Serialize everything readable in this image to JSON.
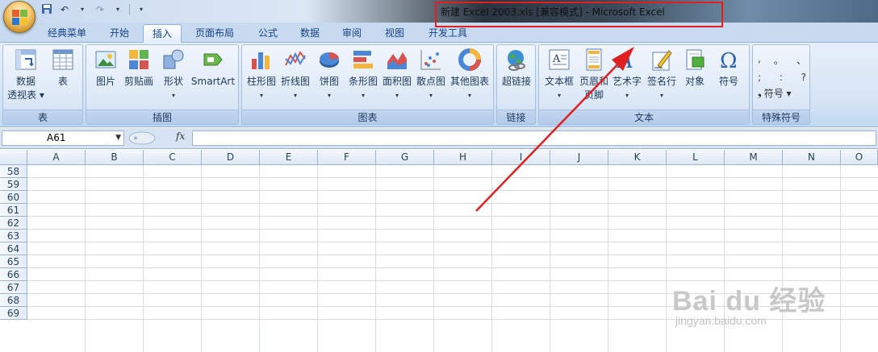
{
  "window": {
    "title": "新建 Excel 2003.xls  [兼容模式] - Microsoft Excel"
  },
  "tabs": [
    {
      "label": "经典菜单",
      "active": false
    },
    {
      "label": "开始",
      "active": false
    },
    {
      "label": "插入",
      "active": true
    },
    {
      "label": "页面布局",
      "active": false
    },
    {
      "label": "公式",
      "active": false
    },
    {
      "label": "数据",
      "active": false
    },
    {
      "label": "审阅",
      "active": false
    },
    {
      "label": "视图",
      "active": false
    },
    {
      "label": "开发工具",
      "active": false
    }
  ],
  "ribbon": {
    "groups": {
      "table": "表",
      "illustrations": "插图",
      "charts": "图表",
      "links": "链接",
      "text": "文本",
      "symbols": "特殊符号"
    },
    "buttons": {
      "pivot": [
        "数据",
        "透视表 ▾"
      ],
      "table": "表",
      "picture": "图片",
      "clipart": "剪贴画",
      "shapes": "形状",
      "smartart": "SmartArt",
      "column": "柱形图",
      "line": "折线图",
      "pie": "饼图",
      "bar": "条形图",
      "area": "面积图",
      "scatter": "散点图",
      "other": "其他图表",
      "hyperlink": "超链接",
      "textbox": "文本框",
      "headerfooter": [
        "页眉和",
        "页脚"
      ],
      "wordart": "艺术字",
      "signature": "签名行",
      "object": "对象",
      "symbol": "符号",
      "special_symbol": "符号 ▾",
      "symbol_chars": [
        ",",
        "。",
        "、",
        ";",
        ":",
        "?",
        "❟"
      ]
    }
  },
  "formula_bar": {
    "name_box": "A61",
    "fx": "fx",
    "content": ""
  },
  "sheet": {
    "columns": [
      "A",
      "B",
      "C",
      "D",
      "E",
      "F",
      "G",
      "H",
      "I",
      "J",
      "K",
      "L",
      "M",
      "N",
      "O"
    ],
    "rows": [
      "58",
      "59",
      "60",
      "61",
      "62",
      "63",
      "64",
      "65",
      "66",
      "67",
      "68",
      "69"
    ]
  },
  "watermark": {
    "brand": "Bai du 经验",
    "url": "jingyan.baidu.com"
  },
  "colors": {
    "highlight": "#e0201e",
    "ribbon": "#dbe7f6"
  }
}
